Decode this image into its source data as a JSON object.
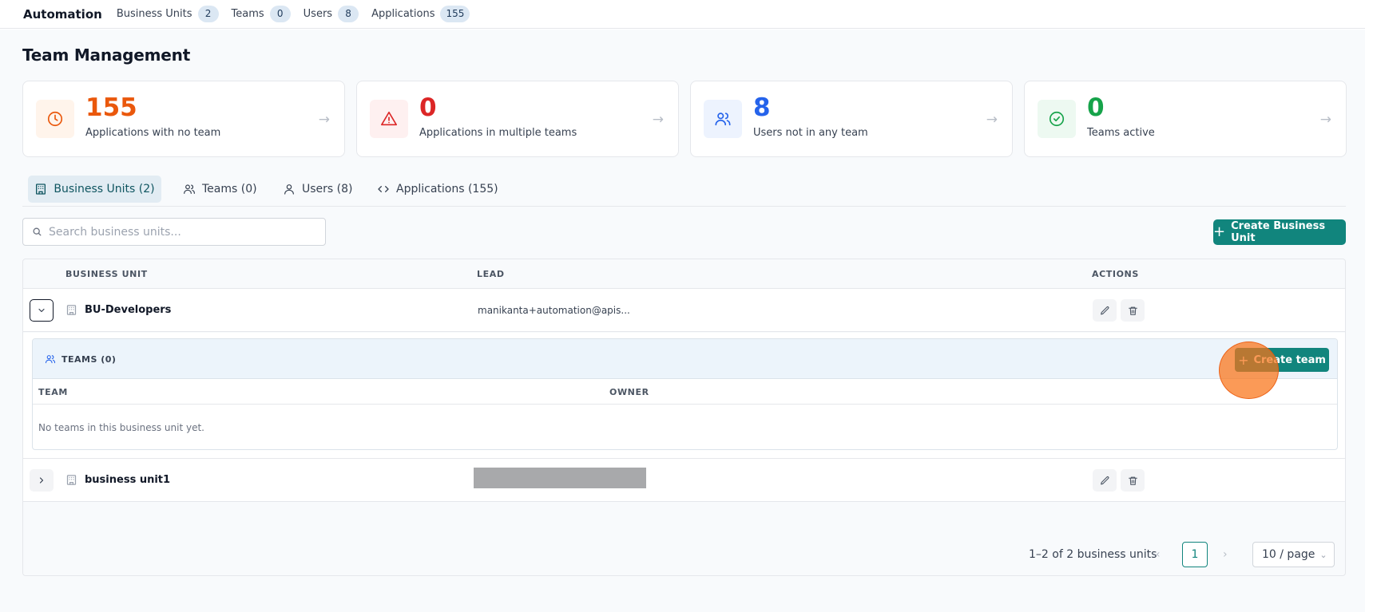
{
  "topnav": {
    "brand": "Automation",
    "items": [
      {
        "label": "Business Units",
        "count": "2"
      },
      {
        "label": "Teams",
        "count": "0"
      },
      {
        "label": "Users",
        "count": "8"
      },
      {
        "label": "Applications",
        "count": "155"
      }
    ]
  },
  "page": {
    "title": "Team Management"
  },
  "stats": [
    {
      "value": "155",
      "label": "Applications with no team",
      "color": "#ea580c",
      "bg": "#fff4eb",
      "icon": "clock-icon"
    },
    {
      "value": "0",
      "label": "Applications in multiple teams",
      "color": "#dc2626",
      "bg": "#fef0f0",
      "icon": "alert-triangle-icon"
    },
    {
      "value": "8",
      "label": "Users not in any team",
      "color": "#2563eb",
      "bg": "#edf3fe",
      "icon": "users-icon"
    },
    {
      "value": "0",
      "label": "Teams active",
      "color": "#16a34a",
      "bg": "#edf9f1",
      "icon": "check-circle-icon"
    }
  ],
  "tabs": [
    {
      "label": "Business Units (2)",
      "icon": "building-icon",
      "active": true
    },
    {
      "label": "Teams (0)",
      "icon": "users-icon",
      "active": false
    },
    {
      "label": "Users (8)",
      "icon": "user-icon",
      "active": false
    },
    {
      "label": "Applications (155)",
      "icon": "code-icon",
      "active": false
    }
  ],
  "search": {
    "placeholder": "Search business units..."
  },
  "actions": {
    "create_business_unit": "Create Business Unit"
  },
  "table": {
    "columns": {
      "business_unit": "BUSINESS UNIT",
      "lead": "LEAD",
      "actions": "ACTIONS"
    },
    "rows": [
      {
        "name": "BU-Developers",
        "lead": "manikanta+automation@apis...",
        "expanded": true
      },
      {
        "name": "business unit1",
        "lead": "",
        "lead_redacted": true,
        "expanded": false
      }
    ],
    "teams_panel": {
      "title": "TEAMS (0)",
      "create_label": "Create team",
      "columns": {
        "team": "TEAM",
        "owner": "OWNER"
      },
      "empty": "No teams in this business unit yet."
    }
  },
  "pagination": {
    "summary": "1–2 of 2 business units",
    "current_page": "1",
    "page_size": "10 / page"
  },
  "colors": {
    "accent": "#11857d",
    "click_marker": "#f97316"
  }
}
